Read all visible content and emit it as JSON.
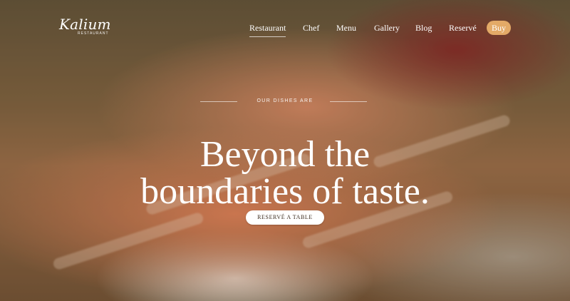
{
  "brand": {
    "name": "Kalium",
    "subtitle": "RESTAURANT"
  },
  "nav": {
    "items": [
      {
        "label": "Restaurant",
        "active": true
      },
      {
        "label": "Chef"
      },
      {
        "label": "Menu"
      },
      {
        "label": "Gallery"
      },
      {
        "label": "Blog"
      },
      {
        "label": "Reservé"
      }
    ],
    "buy_label": "Buy"
  },
  "hero": {
    "eyebrow": "OUR DISHES ARE",
    "headline_line1": "Beyond the",
    "headline_line2": "boundaries of taste.",
    "cta_label": "RESERVÉ A TABLE"
  },
  "colors": {
    "accent": "#e3aa67",
    "text": "#ffffff"
  }
}
